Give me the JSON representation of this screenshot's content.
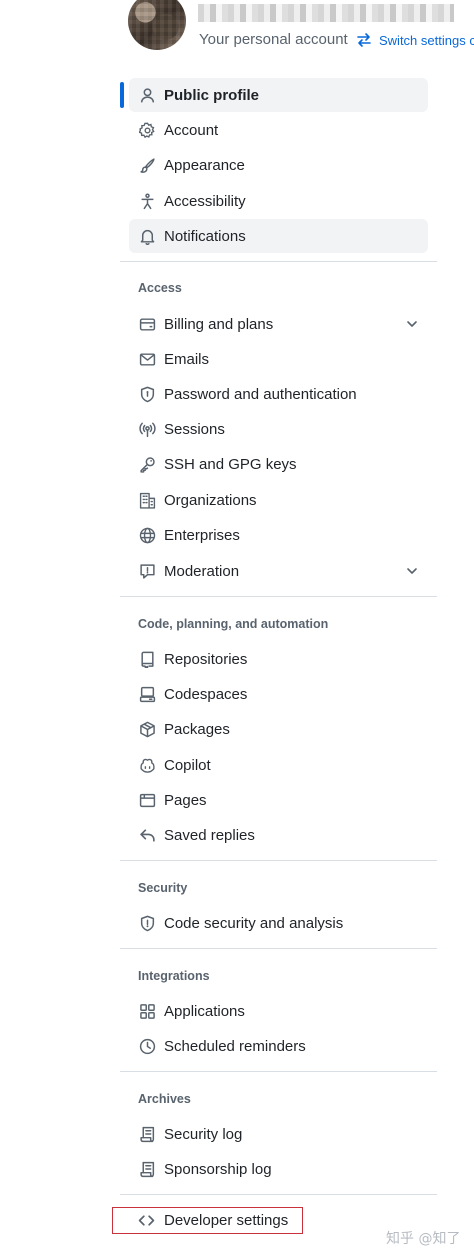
{
  "header": {
    "account_subtitle": "Your personal account",
    "switch_label": "Switch settings c"
  },
  "menu": {
    "public_profile": "Public profile",
    "account": "Account",
    "appearance": "Appearance",
    "accessibility": "Accessibility",
    "notifications": "Notifications"
  },
  "access": {
    "heading": "Access",
    "billing": "Billing and plans",
    "emails": "Emails",
    "password": "Password and authentication",
    "sessions": "Sessions",
    "ssh": "SSH and GPG keys",
    "organizations": "Organizations",
    "enterprises": "Enterprises",
    "moderation": "Moderation"
  },
  "code": {
    "heading": "Code, planning, and automation",
    "repositories": "Repositories",
    "codespaces": "Codespaces",
    "packages": "Packages",
    "copilot": "Copilot",
    "pages": "Pages",
    "saved_replies": "Saved replies"
  },
  "security": {
    "heading": "Security",
    "code_security": "Code security and analysis"
  },
  "integrations": {
    "heading": "Integrations",
    "applications": "Applications",
    "scheduled": "Scheduled reminders"
  },
  "archives": {
    "heading": "Archives",
    "security_log": "Security log",
    "sponsorship_log": "Sponsorship log"
  },
  "developer": {
    "label": "Developer settings"
  },
  "watermark": "知乎 @知了",
  "colors": {
    "accent": "#0969da",
    "highlight_box": "#c9323a",
    "muted": "#59636e"
  }
}
